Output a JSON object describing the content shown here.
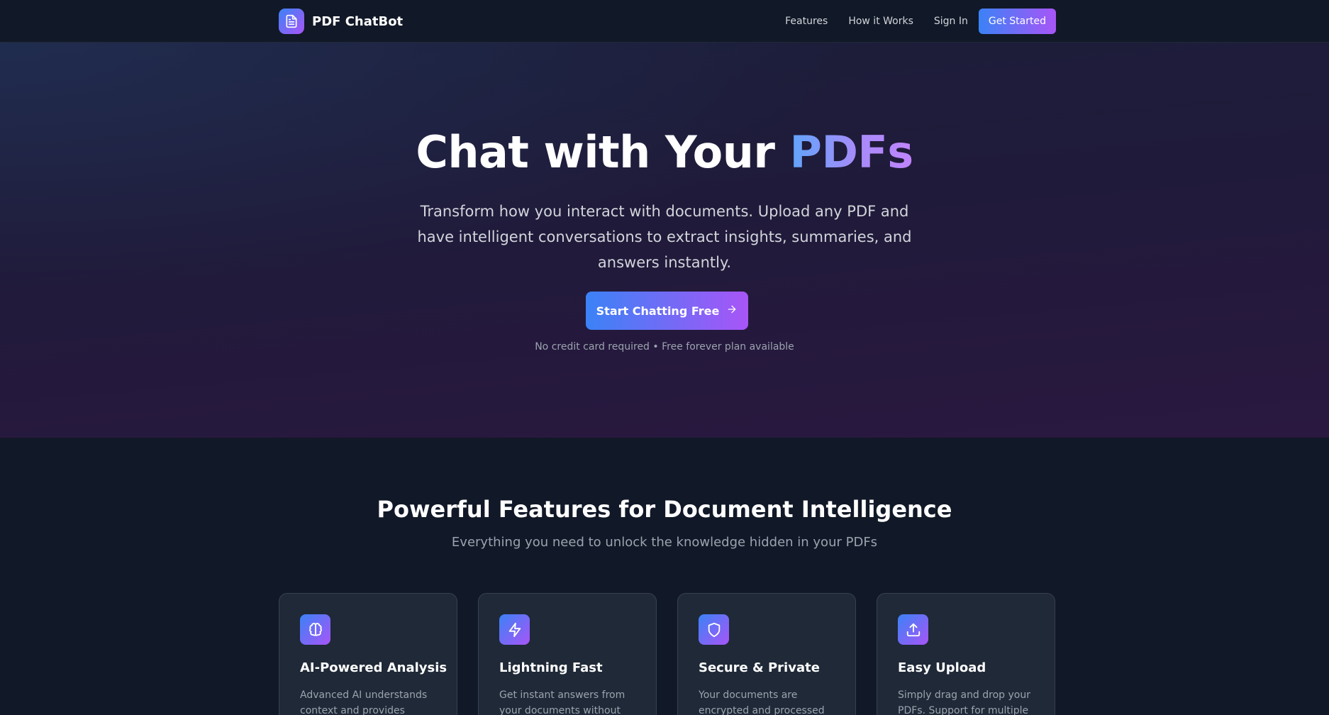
{
  "nav": {
    "brand": "PDF ChatBot",
    "links": [
      "Features",
      "How it Works",
      "Sign In"
    ],
    "cta": "Get Started"
  },
  "hero": {
    "title_main": "Chat with Your",
    "title_accent": "PDFs",
    "subtitle": "Transform how you interact with documents. Upload any PDF and have intelligent conversations to extract insights, summaries, and answers instantly.",
    "cta": "Start Chatting Free",
    "note": "No credit card required • Free forever plan available"
  },
  "features": {
    "title": "Powerful Features for Document Intelligence",
    "subtitle": "Everything you need to unlock the knowledge hidden in your PDFs",
    "cards": [
      {
        "icon": "brain-icon",
        "title": "AI-Powered Analysis",
        "desc": "Advanced AI understands context and provides"
      },
      {
        "icon": "lightning-icon",
        "title": "Lightning Fast",
        "desc": "Get instant answers from your documents without"
      },
      {
        "icon": "shield-icon",
        "title": "Secure & Private",
        "desc": "Your documents are encrypted and processed"
      },
      {
        "icon": "upload-icon",
        "title": "Easy Upload",
        "desc": "Simply drag and drop your PDFs. Support for multiple"
      }
    ]
  },
  "colors": {
    "background": "#111827",
    "accent_start": "#3b82f6",
    "accent_end": "#a855f7",
    "card_bg": "#1f2937",
    "text_muted": "#9ca3af"
  }
}
